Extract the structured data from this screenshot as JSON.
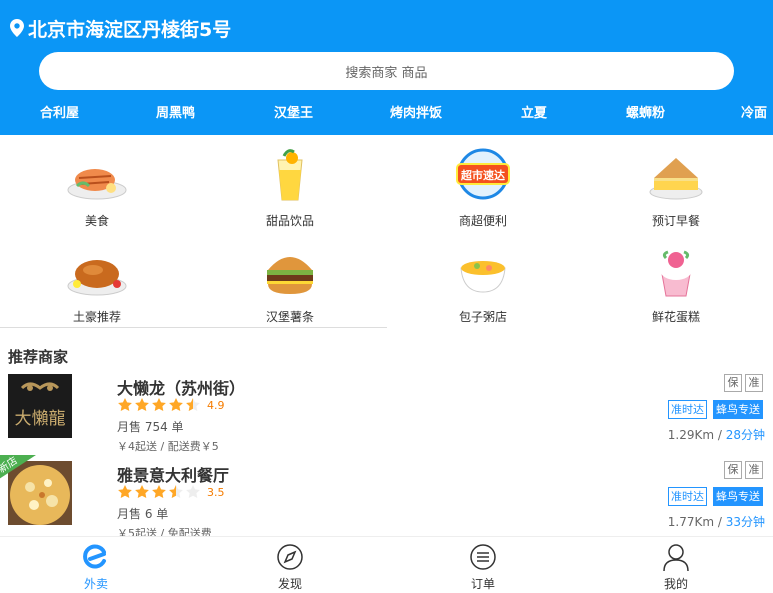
{
  "header": {
    "address": "北京市海淀区丹棱街5号",
    "search_placeholder": "搜索商家 商品",
    "hot_words": [
      "合利屋",
      "周黑鸭",
      "汉堡王",
      "烤肉拌饭",
      "立夏",
      "螺蛳粉",
      "冷面"
    ]
  },
  "categories": [
    {
      "label": "美食",
      "icon": "grilled-salmon-icon"
    },
    {
      "label": "甜品饮品",
      "icon": "drink-cup-icon"
    },
    {
      "label": "商超便利",
      "icon": "supermarket-express-icon"
    },
    {
      "label": "预订早餐",
      "icon": "sandwich-icon"
    },
    {
      "label": "土豪推荐",
      "icon": "roast-chicken-icon"
    },
    {
      "label": "汉堡薯条",
      "icon": "burger-icon"
    },
    {
      "label": "包子粥店",
      "icon": "porridge-bowl-icon"
    },
    {
      "label": "鲜花蛋糕",
      "icon": "cupcake-icon"
    }
  ],
  "supermarket_icon_text": "超市速达",
  "section_title": "推荐商家",
  "shops": [
    {
      "name": "大懒龙（苏州街）",
      "logo_text": "大懶龍",
      "rating": 4.9,
      "score": "4.9",
      "sales": "月售 754 单",
      "fee": "￥4起送 / 配送费￥5",
      "tag_bao": "保",
      "tag_zhun": "准",
      "ontime": "准时达",
      "delivery": "蜂鸟专送",
      "distance": "1.29Km",
      "sep": " / ",
      "time": "28分钟",
      "is_new": false
    },
    {
      "name": "雅景意大利餐厅",
      "rating": 3.5,
      "score": "3.5",
      "sales": "月售 6 单",
      "fee": "￥5起送 / 免配送费",
      "tag_bao": "保",
      "tag_zhun": "准",
      "ontime": "准时达",
      "delivery": "蜂鸟专送",
      "distance": "1.77Km",
      "sep": " / ",
      "time": "33分钟",
      "is_new": true,
      "new_label": "新店"
    }
  ],
  "tabs": [
    {
      "label": "外卖",
      "icon": "eleme-logo-icon",
      "active": true
    },
    {
      "label": "发现",
      "icon": "compass-icon",
      "active": false
    },
    {
      "label": "订单",
      "icon": "order-list-icon",
      "active": false
    },
    {
      "label": "我的",
      "icon": "user-icon",
      "active": false
    }
  ],
  "colors": {
    "header_bg": "#0b96f6",
    "accent": "#2395ff",
    "star": "#ffa726",
    "new_badge": "#4caf50"
  }
}
